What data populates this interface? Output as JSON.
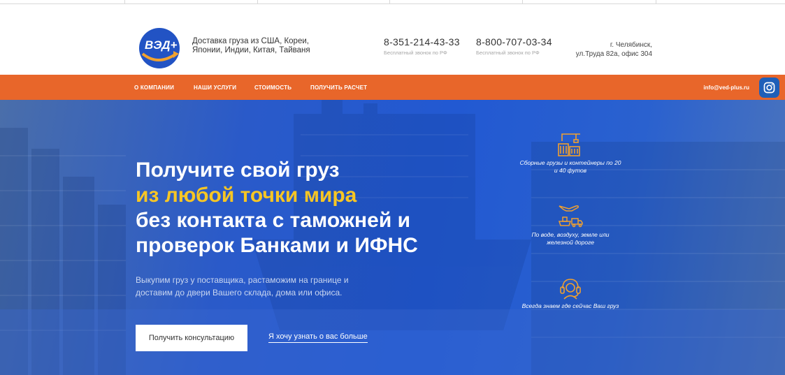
{
  "header": {
    "logo_text": "ВЭД+",
    "tagline": "Доставка груза из США, Кореи, Японии, Индии, Китая, Тайваня",
    "phones": [
      {
        "number": "8-351-214-43-33",
        "note": "Бесплатный звонок по РФ"
      },
      {
        "number": "8-800-707-03-34",
        "note": "Бесплатный звонок по РФ"
      }
    ],
    "address_line1": "г. Челябинск,",
    "address_line2": "ул.Труда 82а, офис 304"
  },
  "nav": {
    "items": [
      "О КОМПАНИИ",
      "НАШИ УСЛУГИ",
      "СТОИМОСТЬ",
      "ПОЛУЧИТЬ РАСЧЕТ"
    ],
    "email": "info@ved-plus.ru"
  },
  "hero": {
    "title_line1": "Получите свой груз",
    "title_line2": "из любой точки мира",
    "title_line3": "без контакта с таможней и",
    "title_line4": "проверок Банками и ИФНС",
    "subtitle": "Выкупим груз у поставщика, растаможим на границе и доставим до двери Вашего склада, дома или офиса.",
    "cta_button": "Получить консультацию",
    "cta_link": "Я хочу узнать о вас больше"
  },
  "features": [
    {
      "icon": "container-crane-icon",
      "caption": "Сборные грузы и контейнеры по 20 и 40 футов"
    },
    {
      "icon": "transport-icon",
      "caption": "По воде, воздуху, земле или железной дороге"
    },
    {
      "icon": "support-headset-icon",
      "caption": "Всегда знаем где сейчас Ваш груз"
    }
  ],
  "colors": {
    "accent_orange": "#e8662a",
    "hero_blue": "#2259d2",
    "highlight_yellow": "#f7c624",
    "icon_orange": "#f0a030"
  }
}
